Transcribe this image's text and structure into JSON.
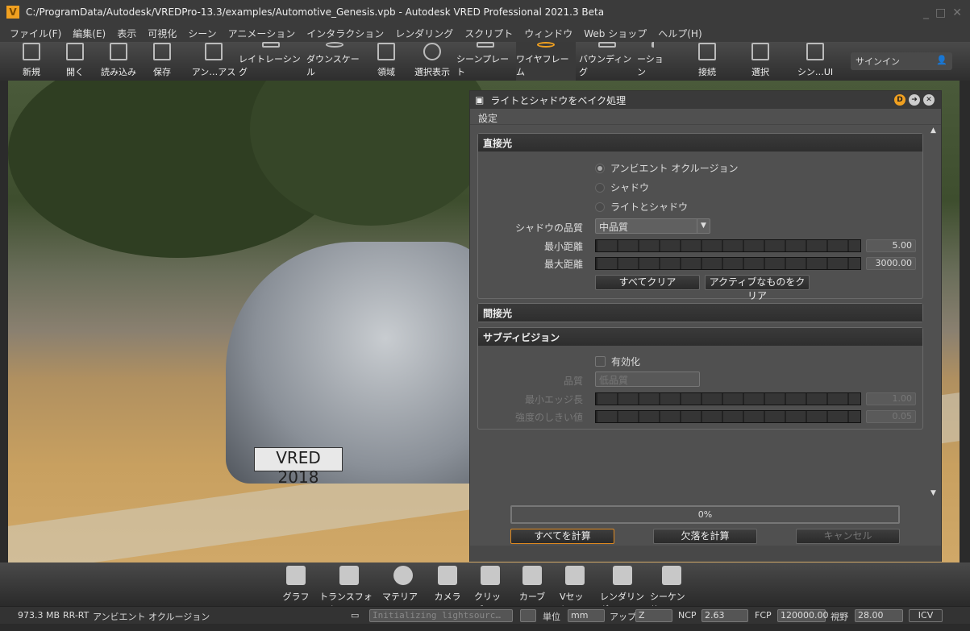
{
  "window": {
    "title": "C:/ProgramData/Autodesk/VREDPro-13.3/examples/Automotive_Genesis.vpb - Autodesk VRED Professional 2021.3 Beta",
    "logo": "V"
  },
  "menu": [
    "ファイル(F)",
    "編集(E)",
    "表示",
    "可視化",
    "シーン",
    "アニメーション",
    "インタラクション",
    "レンダリング",
    "スクリプト",
    "ウィンドウ",
    "Web ショップ",
    "ヘルプ(H)"
  ],
  "toolbar": [
    {
      "label": "新規",
      "icon": "new-file-icon"
    },
    {
      "label": "開く",
      "icon": "folder-open-icon"
    },
    {
      "label": "読み込み",
      "icon": "import-icon"
    },
    {
      "label": "保存",
      "icon": "save-icon"
    },
    {
      "label": "アン…アス",
      "icon": "antialias-icon"
    },
    {
      "label": "レイトレーシング",
      "icon": "cpu-icon"
    },
    {
      "label": "ダウンスケール",
      "icon": "downscale-icon"
    },
    {
      "label": "領域",
      "icon": "region-icon"
    },
    {
      "label": "選択表示",
      "icon": "eye-icon"
    },
    {
      "label": "シーンプレート",
      "icon": "sceneplate-icon"
    },
    {
      "label": "ワイヤフレーム",
      "icon": "wireframe-globe-icon",
      "active": true
    },
    {
      "label": "バウンディング",
      "icon": "bounding-box-icon"
    },
    {
      "label": "ーション",
      "icon": "annotation-icon"
    },
    {
      "label": "接続",
      "icon": "plug-icon"
    },
    {
      "label": "選択",
      "icon": "select-icon"
    },
    {
      "label": "シン…UI",
      "icon": "ui-icon"
    }
  ],
  "signin": {
    "label": "サインイン",
    "icon": "user-icon"
  },
  "viewport": {
    "plate_text": "VRED 2018"
  },
  "dialog": {
    "title": "ライトとシャドウをベイク処理",
    "menu": "設定",
    "direct": {
      "header": "直接光",
      "modes": [
        {
          "label": "アンビエント オクルージョン",
          "selected": true
        },
        {
          "label": "シャドウ",
          "selected": false
        },
        {
          "label": "ライトとシャドウ",
          "selected": false
        }
      ],
      "quality_label": "シャドウの品質",
      "quality_value": "中品質",
      "min_label": "最小距離",
      "min_value": "5.00",
      "max_label": "最大距離",
      "max_value": "3000.00",
      "clear_all": "すべてクリア",
      "clear_active": "アクティブなものをクリア"
    },
    "indirect": {
      "header": "間接光"
    },
    "subdivision": {
      "header": "サブディビジョン",
      "enable_label": "有効化",
      "enabled": false,
      "quality_label": "品質",
      "quality_value": "低品質",
      "min_edge_label": "最小エッジ長",
      "min_edge_value": "1.00",
      "threshold_label": "強度のしきい値",
      "threshold_value": "0.05"
    },
    "progress": {
      "text": "0%",
      "value": 0
    },
    "buttons": {
      "compute_all": "すべてを計算",
      "compute_missing": "欠落を計算",
      "cancel": "キャンセル"
    }
  },
  "dock": [
    {
      "label": "グラフ"
    },
    {
      "label": "トランスフォーム"
    },
    {
      "label": "マテリアル"
    },
    {
      "label": "カメラ"
    },
    {
      "label": "クリップ"
    },
    {
      "label": "カーブ"
    },
    {
      "label": "Vセット"
    },
    {
      "label": "レンダリング"
    },
    {
      "label": "シーケンサ"
    }
  ],
  "status": {
    "memory": "973.3 MB",
    "renderer": "RR-RT",
    "mode": "アンビエント オクルージョン",
    "console": "Initializing lightsourc…",
    "unit_label": "単位",
    "unit": "mm",
    "up_label": "アップ",
    "up": "Z",
    "ncp_label": "NCP",
    "ncp": "2.63",
    "fcp_label": "FCP",
    "fcp": "120000.00",
    "fov_label": "視野",
    "fov": "28.00",
    "icv": "ICV"
  },
  "colors": {
    "accent": "#f0a020",
    "panel": "#505050"
  }
}
